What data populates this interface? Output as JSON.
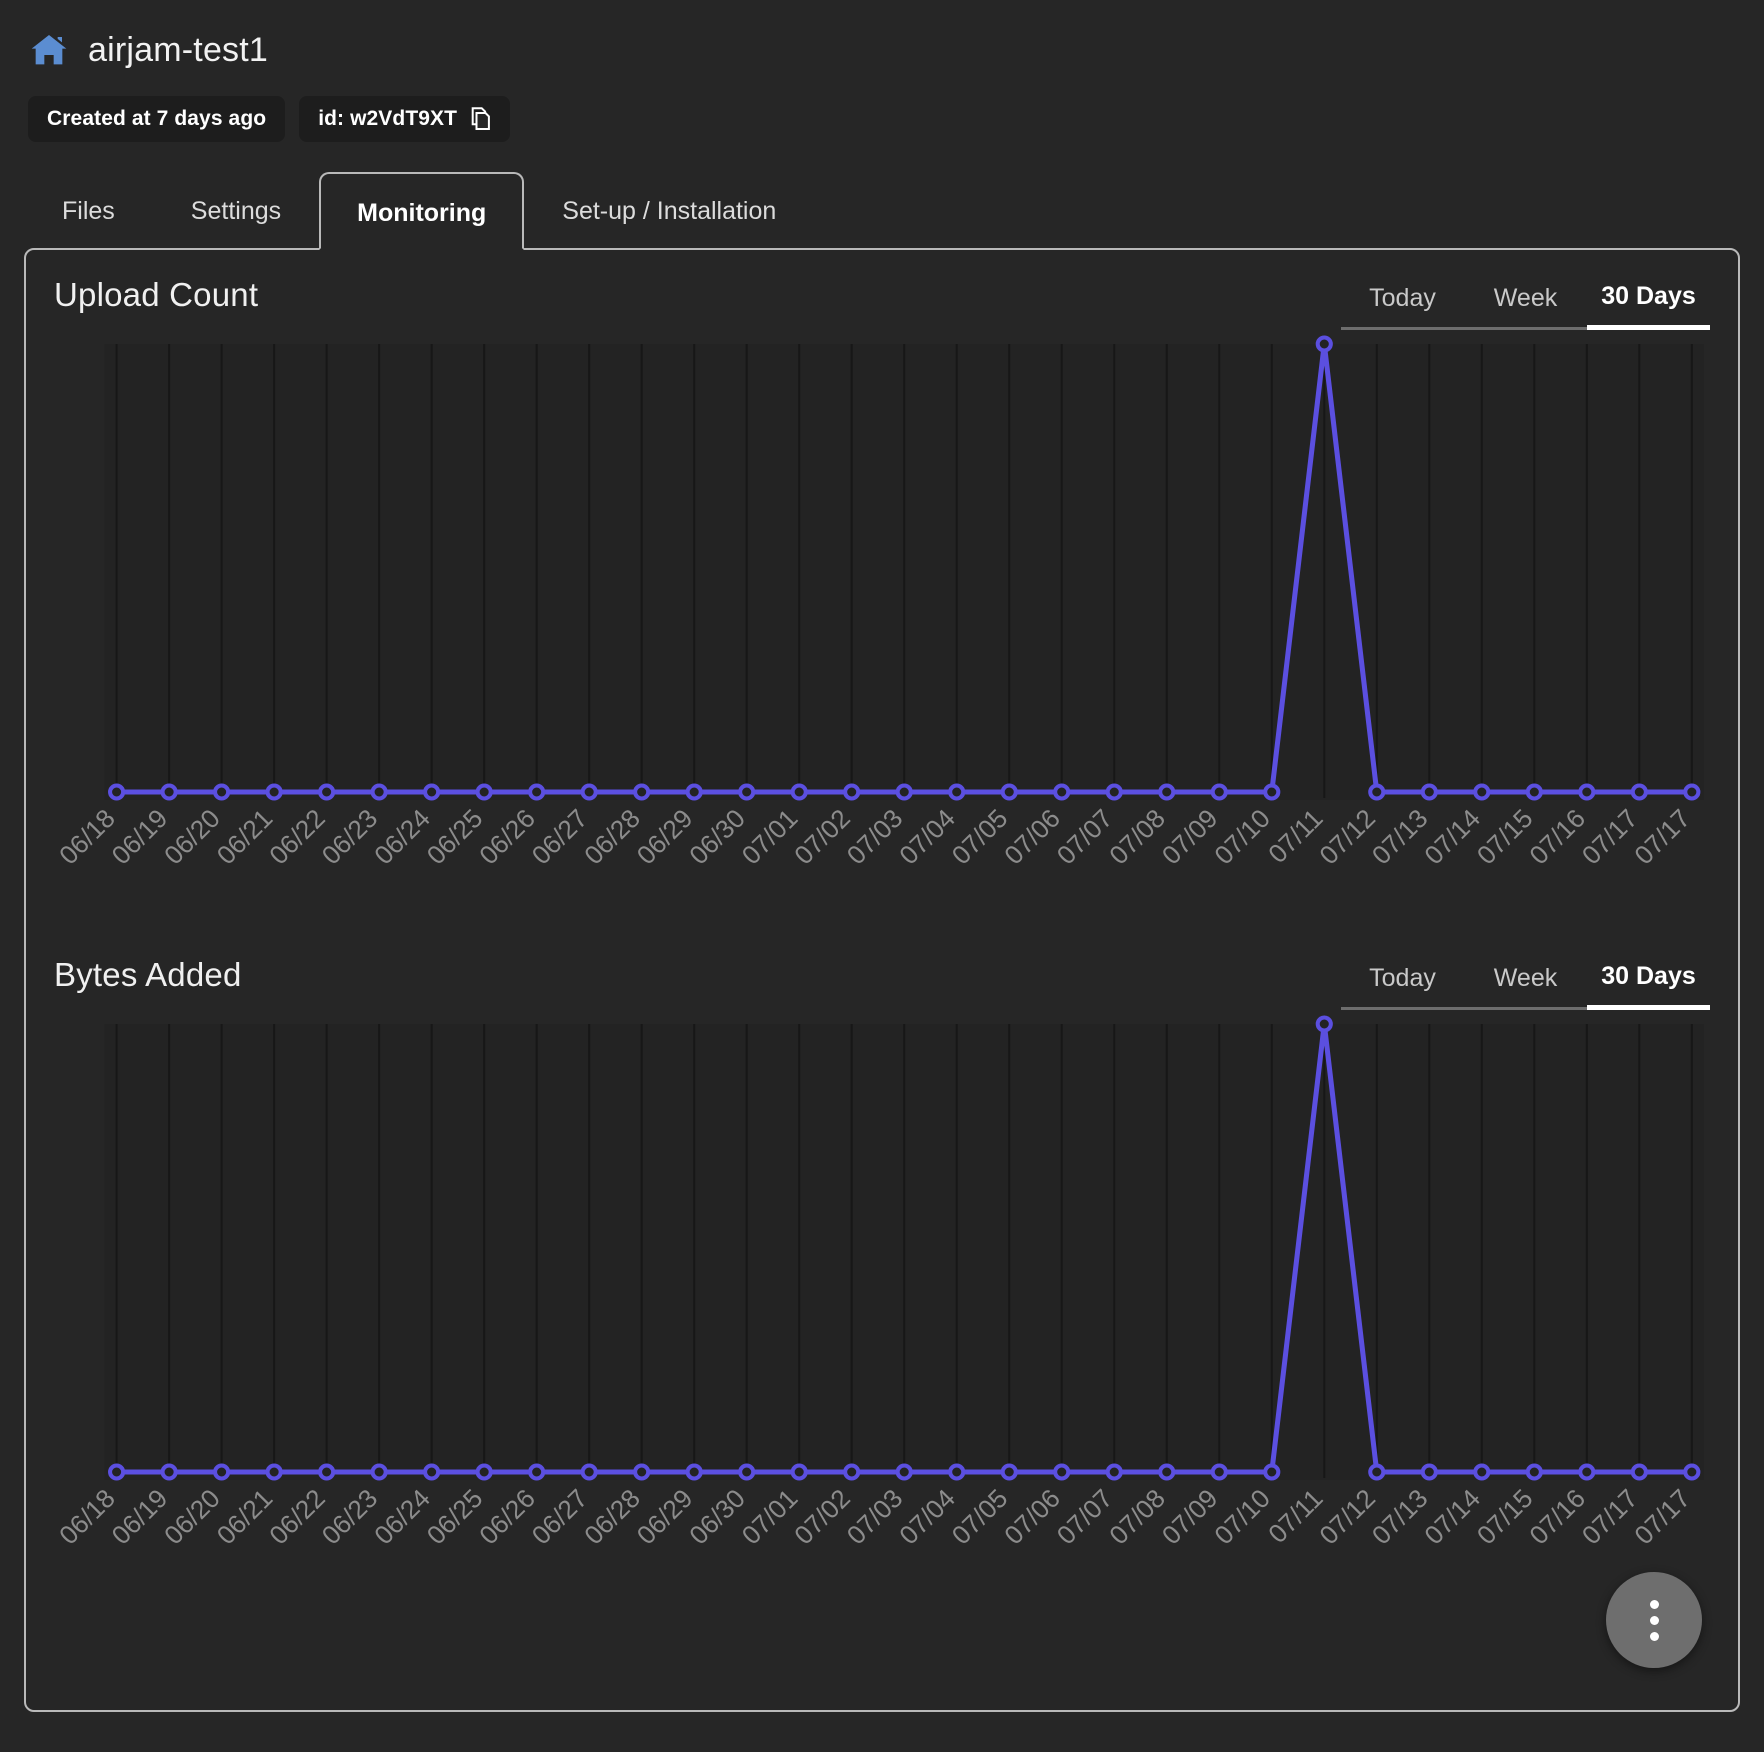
{
  "header": {
    "home_icon": "home-icon",
    "title": "airjam-test1",
    "chips": [
      {
        "label": "Created at 7 days ago",
        "icon": null
      },
      {
        "label": "id: w2VdT9XT",
        "icon": "copy-icon"
      }
    ]
  },
  "tabs": [
    {
      "label": "Files",
      "active": false
    },
    {
      "label": "Settings",
      "active": false
    },
    {
      "label": "Monitoring",
      "active": true
    },
    {
      "label": "Set-up / Installation",
      "active": false
    }
  ],
  "range_options": [
    "Today",
    "Week",
    "30 Days"
  ],
  "selected_range": "30 Days",
  "fab": {
    "name": "more-options",
    "icon": "three-dots-vertical-icon"
  },
  "colors": {
    "accent_line": "#5b4fe0",
    "panel_border": "#b9b9b9",
    "background": "#262626",
    "plot_background": "#232323",
    "gridline": "#171717",
    "axis_label": "#8c8c8c",
    "home_icon": "#5b8dd1",
    "fab_background": "#6e6e6e"
  },
  "chart_data": [
    {
      "type": "line",
      "title": "Upload Count",
      "xlabel": "",
      "ylabel": "",
      "grid": true,
      "legend": "none",
      "selected_range": "30 Days",
      "categories": [
        "06/18",
        "06/19",
        "06/20",
        "06/21",
        "06/22",
        "06/23",
        "06/24",
        "06/25",
        "06/26",
        "06/27",
        "06/28",
        "06/29",
        "06/30",
        "07/01",
        "07/02",
        "07/03",
        "07/04",
        "07/05",
        "07/06",
        "07/07",
        "07/08",
        "07/09",
        "07/10",
        "07/11",
        "07/12",
        "07/13",
        "07/14",
        "07/15",
        "07/16",
        "07/17",
        "07/17"
      ],
      "values": [
        0,
        0,
        0,
        0,
        0,
        0,
        0,
        0,
        0,
        0,
        0,
        0,
        0,
        0,
        0,
        0,
        0,
        0,
        0,
        0,
        0,
        0,
        0,
        100,
        0,
        0,
        0,
        0,
        0,
        0,
        0
      ],
      "ylim": [
        0,
        100
      ]
    },
    {
      "type": "line",
      "title": "Bytes Added",
      "xlabel": "",
      "ylabel": "",
      "grid": true,
      "legend": "none",
      "selected_range": "30 Days",
      "categories": [
        "06/18",
        "06/19",
        "06/20",
        "06/21",
        "06/22",
        "06/23",
        "06/24",
        "06/25",
        "06/26",
        "06/27",
        "06/28",
        "06/29",
        "06/30",
        "07/01",
        "07/02",
        "07/03",
        "07/04",
        "07/05",
        "07/06",
        "07/07",
        "07/08",
        "07/09",
        "07/10",
        "07/11",
        "07/12",
        "07/13",
        "07/14",
        "07/15",
        "07/16",
        "07/17",
        "07/17"
      ],
      "values": [
        0,
        0,
        0,
        0,
        0,
        0,
        0,
        0,
        0,
        0,
        0,
        0,
        0,
        0,
        0,
        0,
        0,
        0,
        0,
        0,
        0,
        0,
        0,
        100,
        0,
        0,
        0,
        0,
        0,
        0,
        0
      ],
      "ylim": [
        0,
        100
      ]
    }
  ]
}
